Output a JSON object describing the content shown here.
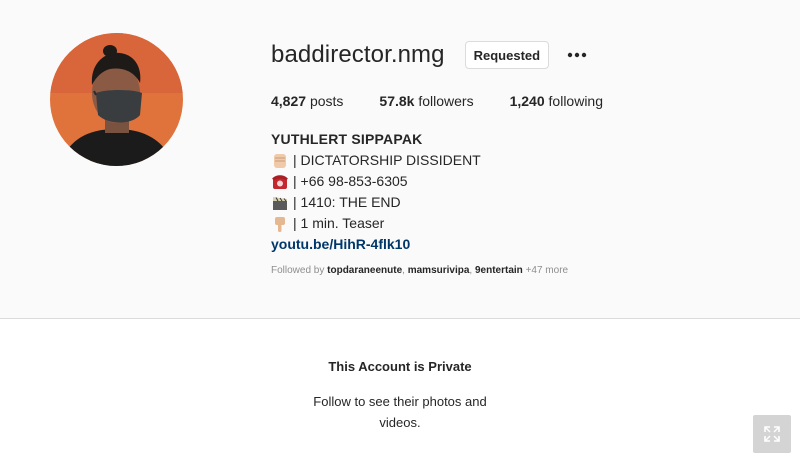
{
  "profile": {
    "username": "baddirector.nmg",
    "request_button_label": "Requested",
    "more_button_label": "•••",
    "stats": {
      "posts_count": "4,827",
      "posts_label": "posts",
      "followers_count": "57.8k",
      "followers_label": "followers",
      "following_count": "1,240",
      "following_label": "following"
    },
    "bio": {
      "full_name": "YUTHLERT SIPPAPAK",
      "lines": [
        {
          "icon": "raised-fist-icon",
          "text": "| DICTATORSHIP DISSIDENT"
        },
        {
          "icon": "telephone-icon",
          "text": "| +66 98-853-6305"
        },
        {
          "icon": "clapper-board-icon",
          "text": "| 1410: THE END"
        },
        {
          "icon": "pointing-down-icon",
          "text": "| 1 min. Teaser"
        }
      ],
      "link": "youtu.be/HihR-4flk10"
    },
    "followed_by": {
      "prefix": "Followed by",
      "users": [
        "topdaraneenute",
        "mamsurivipa",
        "9entertain"
      ],
      "more": "+47 more"
    }
  },
  "private_notice": {
    "title": "This Account is Private",
    "subtitle": "Follow to see their photos and videos."
  },
  "colors": {
    "background": "#fafafa",
    "text": "#262626",
    "muted": "#8e8e8e",
    "link": "#00376b",
    "border": "#dbdbdb",
    "avatar_bg": "#e0733c"
  }
}
